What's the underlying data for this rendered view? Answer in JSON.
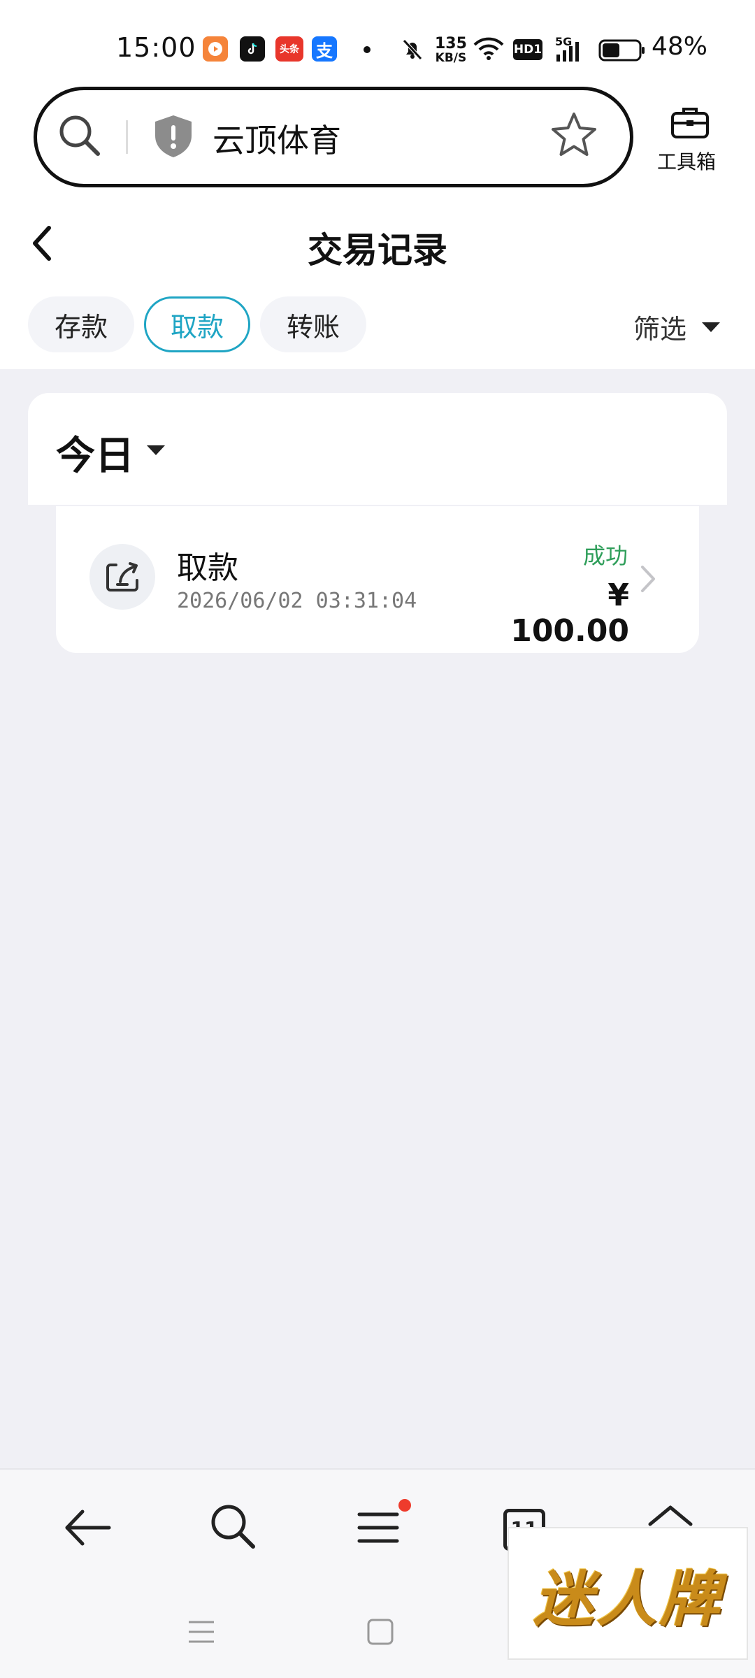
{
  "status_bar": {
    "time": "15:00",
    "apps": [
      {
        "name": "video-app-icon",
        "color": "#f5843a"
      },
      {
        "name": "douyin-icon",
        "color": "#111111"
      },
      {
        "name": "toutiao-icon",
        "color": "#e8362b",
        "label": "头条"
      },
      {
        "name": "alipay-icon",
        "color": "#1677ff",
        "label": "支"
      }
    ],
    "net_speed_value": "135",
    "net_speed_unit": "KB/S",
    "hd_label": "HD1",
    "signal_label": "5G",
    "battery_percent": "48%",
    "battery_level": 0.48
  },
  "browser": {
    "address_text": "云顶体育",
    "toolbox_label": "工具箱"
  },
  "header": {
    "title": "交易记录"
  },
  "tabs": [
    {
      "label": "存款",
      "active": false
    },
    {
      "label": "取款",
      "active": true
    },
    {
      "label": "转账",
      "active": false
    }
  ],
  "filter": {
    "label": "筛选"
  },
  "date_group": {
    "label": "今日"
  },
  "records": [
    {
      "title": "取款",
      "time": "2026/06/02 03:31:04",
      "status": "成功",
      "amount": "¥ 100.00"
    }
  ],
  "bottom_nav": {
    "tab_count": "11"
  },
  "watermark": {
    "text": "迷人牌"
  },
  "colors": {
    "accent": "#1fa5c4",
    "success": "#2f9e5a",
    "background": "#f0f0f5"
  }
}
